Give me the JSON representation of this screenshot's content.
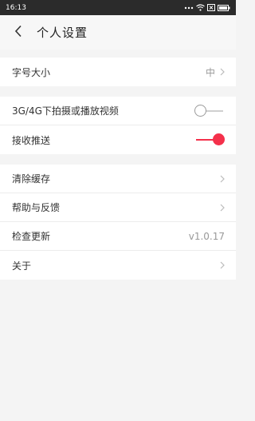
{
  "status_bar": {
    "time": "16:13",
    "icons": [
      "more-dots-icon",
      "wifi-icon",
      "close-box-icon",
      "battery-icon"
    ]
  },
  "header": {
    "title": "个人设置",
    "back_icon": "chevron-left-icon"
  },
  "groups": [
    {
      "items": [
        {
          "label": "字号大小",
          "value": "中",
          "chevron": true
        }
      ]
    },
    {
      "items": [
        {
          "label": "3G/4G下拍摄或播放视频",
          "toggle": false
        },
        {
          "label": "接收推送",
          "toggle": true
        }
      ]
    },
    {
      "items": [
        {
          "label": "清除缓存",
          "chevron": true
        },
        {
          "label": "帮助与反馈",
          "chevron": true
        },
        {
          "label": "检查更新",
          "value": "v1.0.17"
        },
        {
          "label": "关于",
          "chevron": true
        }
      ]
    }
  ],
  "colors": {
    "accent": "#f4304b",
    "status_bar": "#2b2b2b",
    "background": "#f4f4f4"
  }
}
